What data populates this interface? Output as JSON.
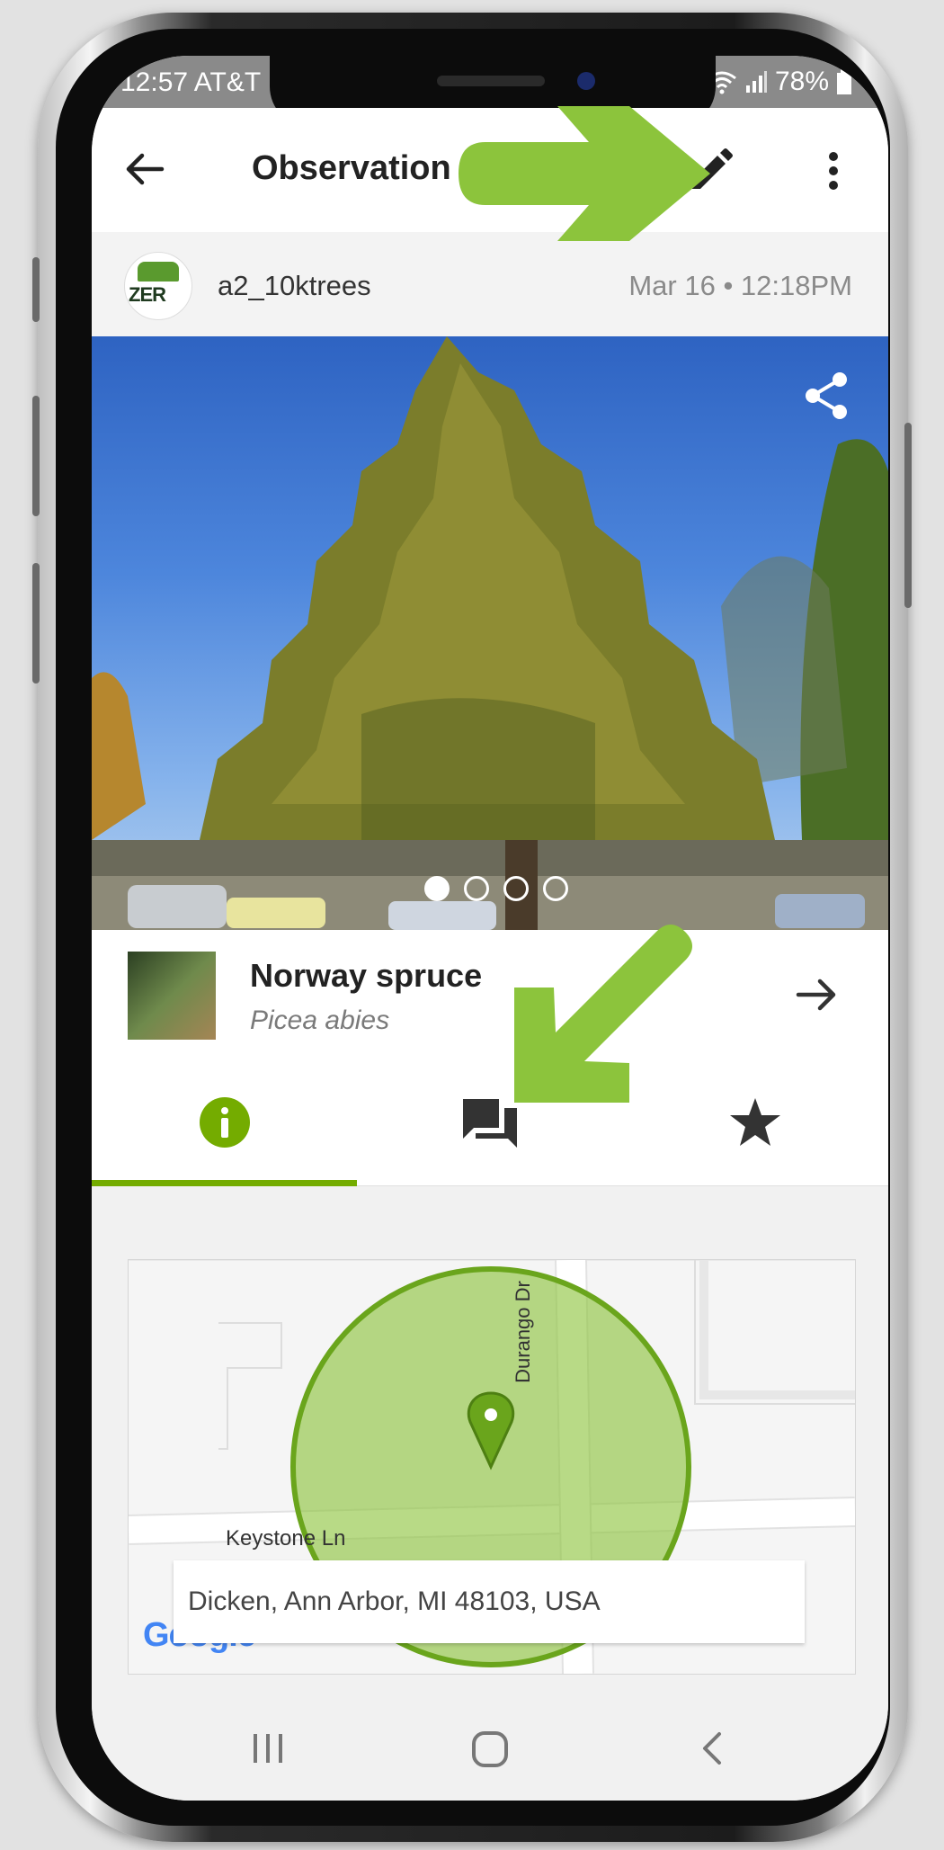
{
  "status_bar": {
    "time_carrier": "12:57 AT&T",
    "battery": "78%"
  },
  "app_bar": {
    "title": "Observation",
    "icons": [
      "back-arrow-icon",
      "pencil-edit-icon",
      "more-vert-icon"
    ]
  },
  "observer": {
    "username": "a2_10ktrees",
    "date": "Mar 16 • 12:18PM",
    "avatar_logo_text": "ZER"
  },
  "photo": {
    "photo_count": 4,
    "active_index": 0,
    "icon": "share-icon"
  },
  "taxon": {
    "common_name": "Norway spruce",
    "scientific_name": "Picea abies"
  },
  "tabs": [
    {
      "icon": "info-icon",
      "selected": true
    },
    {
      "icon": "comments-icon",
      "selected": false
    },
    {
      "icon": "star-icon",
      "selected": false
    }
  ],
  "map": {
    "street_1": "Durango Dr",
    "street_2": "Keystone Ln",
    "address": "Dicken, Ann Arbor, MI 48103, USA",
    "brand": "Google"
  },
  "colors": {
    "accent": "#74ac00",
    "highlight_arrow": "#8cc43c",
    "status_bar": "#8a8a8a"
  }
}
